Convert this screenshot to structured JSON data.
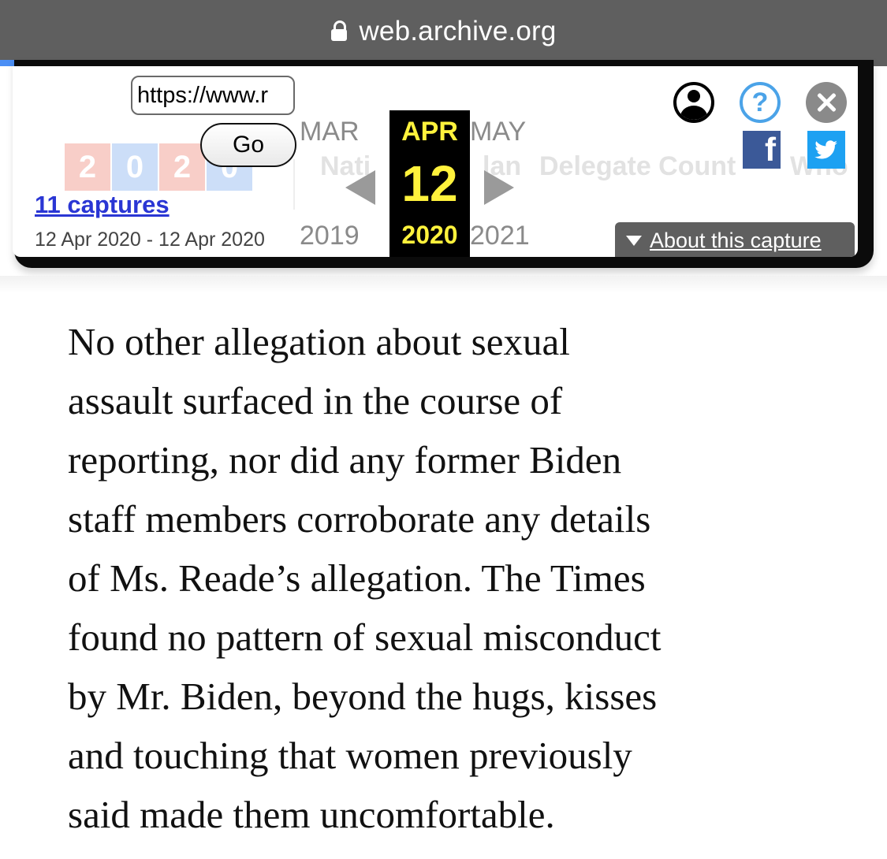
{
  "browser": {
    "url": "web.archive.org",
    "lock_icon": "lock-icon"
  },
  "wayback": {
    "url_input_value": "https://www.r",
    "go_label": "Go",
    "captures_link": "11 captures",
    "capture_range": "12 Apr 2020 - 12 Apr 2020",
    "logo_digits": [
      "2",
      "0",
      "2",
      "0"
    ],
    "logo_colors": [
      "#e8543c",
      "#4a8be8",
      "#e8543c",
      "#4a8be8"
    ],
    "ghost_text": [
      "Nati",
      "lan",
      "Delegate Count",
      "Who"
    ],
    "months": {
      "prev": "MAR",
      "current": "APR",
      "next": "MAY"
    },
    "day": "12",
    "years": {
      "prev": "2019",
      "current": "2020",
      "next": "2021"
    },
    "about_label": "About this capture",
    "icons": {
      "user": "user-account-icon",
      "help": "?",
      "close": "close-icon",
      "facebook": "f",
      "twitter": "twitter-icon"
    },
    "colors": {
      "calendar_bg": "#000000",
      "calendar_text": "#fff23c",
      "link": "#2a36d4",
      "facebook": "#3b5998",
      "twitter": "#1da1f2",
      "help": "#4ba3e8"
    }
  },
  "article": {
    "lines": [
      "No other allegation about sexual",
      "assault surfaced in the course of",
      "reporting, nor did any former Biden",
      "staff members corroborate any details",
      "of Ms. Reade’s allegation. The Times",
      "found no pattern of sexual misconduct",
      "by Mr. Biden, beyond the hugs, kisses",
      "and touching that women previously",
      "said made them uncomfortable."
    ]
  }
}
